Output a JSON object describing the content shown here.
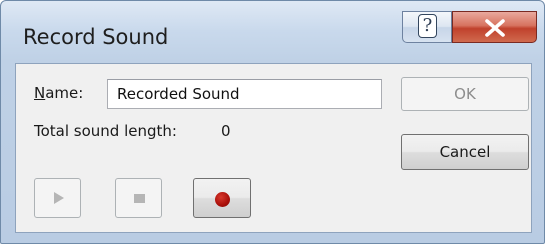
{
  "window": {
    "title": "Record Sound",
    "help_glyph": "?",
    "close_icon": "close-x-icon"
  },
  "form": {
    "name_label_accel": "N",
    "name_label_rest": "ame:",
    "name_value": "Recorded Sound",
    "length_label": "Total sound length:",
    "length_value": "0"
  },
  "buttons": {
    "ok": "OK",
    "cancel": "Cancel",
    "play_icon": "play-icon",
    "stop_icon": "stop-icon",
    "record_icon": "record-icon"
  },
  "colors": {
    "close_button": "#c9473a",
    "record_dot": "#b0120c",
    "title_gradient_top": "#dfe9f5"
  }
}
